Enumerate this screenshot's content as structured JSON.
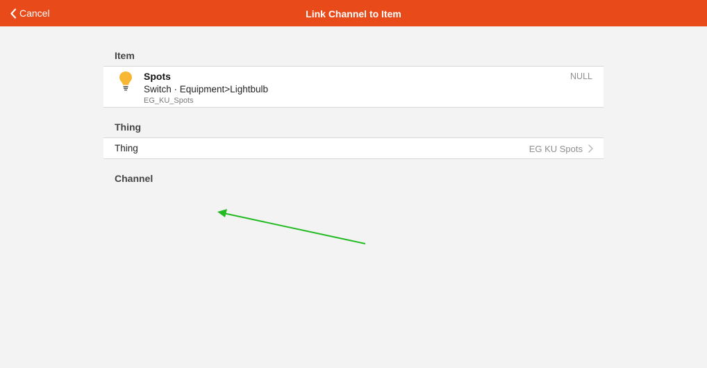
{
  "navbar": {
    "back_label": "Cancel",
    "title": "Link Channel to Item",
    "background": "#e84a1a"
  },
  "item_section": {
    "title": "Item",
    "item": {
      "icon": "lightbulb-icon",
      "icon_color": "#f7b734",
      "name": "Spots",
      "subtitle": "Switch · Equipment>Lightbulb",
      "footer": "EG_KU_Spots",
      "state": "NULL"
    }
  },
  "thing_section": {
    "title": "Thing",
    "row_label": "Thing",
    "selected_value": "EG KU Spots",
    "chevron": "chevron-right-icon"
  },
  "channel_section": {
    "title": "Channel"
  },
  "annotation": {
    "icon": "green-arrow-annotation",
    "color": "#22bb22"
  }
}
